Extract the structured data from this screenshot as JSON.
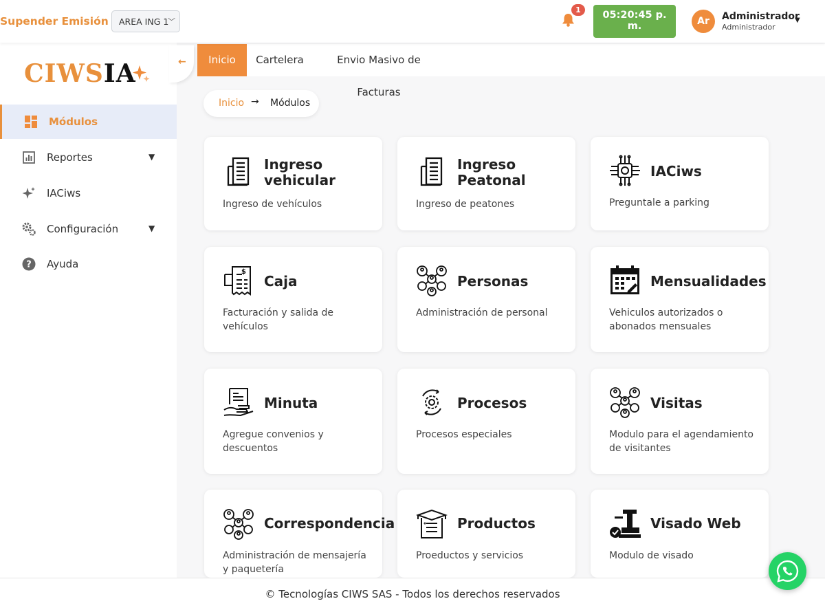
{
  "topbar": {
    "suspend_label": "Supender Emisión",
    "area_select": {
      "value": "AREA ING 1"
    },
    "notifications": {
      "count": "1"
    },
    "clock": {
      "line1": "05:20:45 p.",
      "line2": "m."
    },
    "user": {
      "initials": "Ar",
      "name": "Administrador",
      "role": "Administrador"
    }
  },
  "sidebar": {
    "logo": {
      "part1": "CIWS",
      "part2": "IA"
    },
    "items": [
      {
        "label": "Módulos",
        "icon": "dashboard-icon"
      },
      {
        "label": "Reportes",
        "icon": "report-icon"
      },
      {
        "label": "IACiws",
        "icon": "sparkle-icon"
      },
      {
        "label": "Configuración",
        "icon": "gears-icon"
      },
      {
        "label": "Ayuda",
        "icon": "help-icon"
      }
    ]
  },
  "tabs": [
    {
      "label": "Inicio"
    },
    {
      "label": "Cartelera"
    },
    {
      "label": "Envio Masivo de Facturas"
    }
  ],
  "breadcrumb": {
    "home": "Inicio",
    "arrow": "→",
    "current": "Módulos"
  },
  "modules": [
    {
      "title1": "Ingreso",
      "title2": "vehicular",
      "desc": "Ingreso de vehículos",
      "icon": "building-doc-icon"
    },
    {
      "title1": "Ingreso",
      "title2": "Peatonal",
      "desc": "Ingreso de peatones",
      "icon": "building-doc-icon"
    },
    {
      "title1": "IACiws",
      "title2": "",
      "desc": "Preguntale a parking",
      "icon": "ai-chip-icon"
    },
    {
      "title1": "Caja",
      "title2": "",
      "desc": "Facturación y salida de vehículos",
      "icon": "receipt-icon"
    },
    {
      "title1": "Personas",
      "title2": "",
      "desc": "Administración de personal",
      "icon": "people-network-icon"
    },
    {
      "title1": "Mensualidades",
      "title2": "",
      "desc": "Vehiculos autorizados o abonados mensuales",
      "icon": "calendar-icon"
    },
    {
      "title1": "Minuta",
      "title2": "",
      "desc": "Agregue convenios y descuentos",
      "icon": "document-hand-icon"
    },
    {
      "title1": "Procesos",
      "title2": "",
      "desc": "Procesos especiales",
      "icon": "process-gear-icon"
    },
    {
      "title1": "Visitas",
      "title2": "",
      "desc": "Modulo para el agendamiento de visitantes",
      "icon": "people-network-icon"
    },
    {
      "title1": "Correspondencia",
      "title2": "",
      "desc": "Administración de mensajería y paquetería",
      "icon": "people-network-icon"
    },
    {
      "title1": "Productos",
      "title2": "",
      "desc": "Proeductos y servicios",
      "icon": "box-list-icon"
    },
    {
      "title1": "Visado Web",
      "title2": "",
      "desc": "Modulo de visado",
      "icon": "stamp-check-icon"
    }
  ],
  "footer": {
    "text": "© Tecnologías CIWS SAS - Todos los derechos reservados"
  },
  "colors": {
    "accent": "#ef8c3c",
    "clock": "#6ab04c",
    "badge": "#e35a4a",
    "whatsapp": "#25d366"
  }
}
